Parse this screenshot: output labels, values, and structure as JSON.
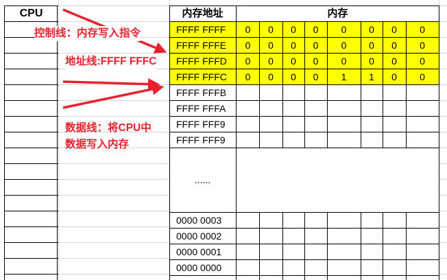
{
  "cpu": {
    "label": "CPU"
  },
  "memory": {
    "address_header": "内存地址",
    "memory_header": "内存",
    "ellipsis": "......",
    "highlight_color": "#ffff00",
    "rows_top": [
      {
        "address": "FFFF FFFF",
        "cells": [
          "0",
          "0",
          "0",
          "0",
          "0",
          "0",
          "0",
          "0"
        ],
        "highlighted": true
      },
      {
        "address": "FFFF FFFE",
        "cells": [
          "0",
          "0",
          "0",
          "0",
          "0",
          "0",
          "0",
          "0"
        ],
        "highlighted": true
      },
      {
        "address": "FFFF FFFD",
        "cells": [
          "0",
          "0",
          "0",
          "0",
          "0",
          "0",
          "0",
          "0"
        ],
        "highlighted": true
      },
      {
        "address": "FFFF FFFC",
        "cells": [
          "0",
          "0",
          "0",
          "0",
          "1",
          "1",
          "0",
          "0"
        ],
        "highlighted": true
      },
      {
        "address": "FFFF FFFB",
        "cells": [
          "",
          "",
          "",
          "",
          "",
          "",
          "",
          ""
        ],
        "highlighted": false
      },
      {
        "address": "FFFF FFFA",
        "cells": [
          "",
          "",
          "",
          "",
          "",
          "",
          "",
          ""
        ],
        "highlighted": false
      },
      {
        "address": "FFFF FFF9",
        "cells": [
          "",
          "",
          "",
          "",
          "",
          "",
          "",
          ""
        ],
        "highlighted": false
      },
      {
        "address": "FFFF FFF9",
        "cells": [
          "",
          "",
          "",
          "",
          "",
          "",
          "",
          ""
        ],
        "highlighted": false
      }
    ],
    "rows_bottom": [
      {
        "address": "0000 0003"
      },
      {
        "address": "0000 0002"
      },
      {
        "address": "0000 0001"
      },
      {
        "address": "0000 0000"
      }
    ]
  },
  "annotations": {
    "control_line": "控制线：内存写入指令",
    "address_line": "地址线:FFFF FFFC",
    "data_line_1": "数据线：将CPU中",
    "data_line_2": "数据写入内存",
    "arrow_color": "#e8212e"
  }
}
